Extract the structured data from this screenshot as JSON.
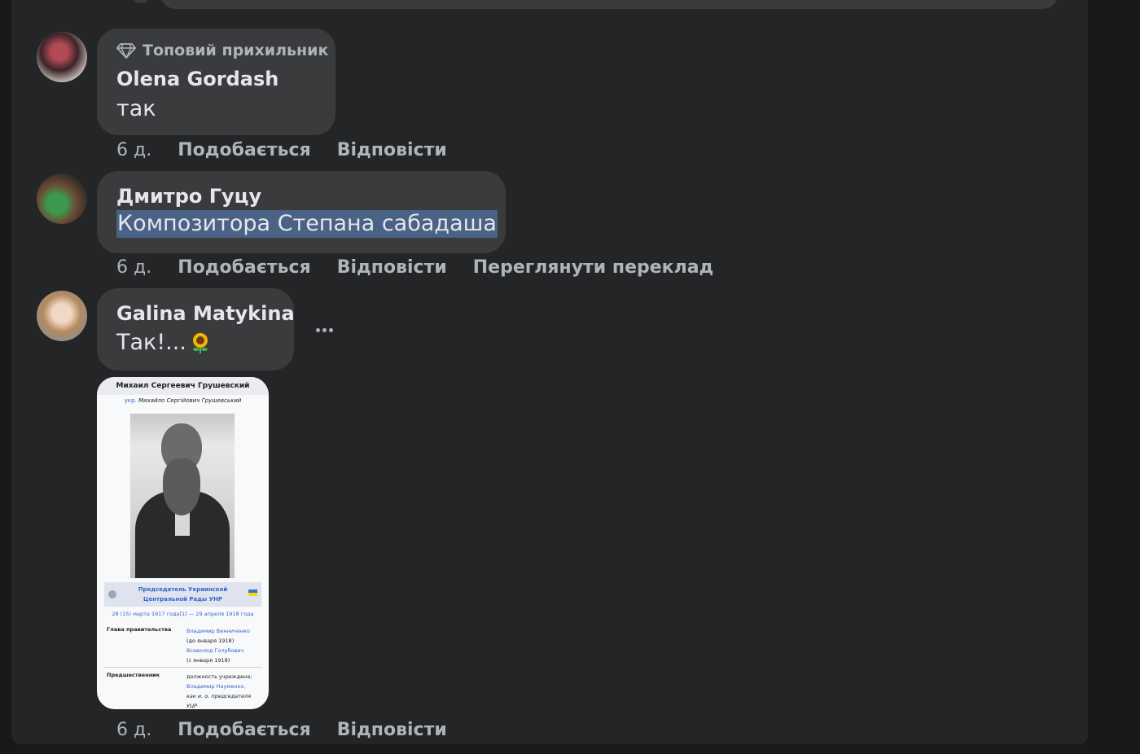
{
  "comments": [
    {
      "badge": "Топовий прихильник",
      "author": "Olena Gordash",
      "text": "так",
      "time": "6 д.",
      "like": "Подобається",
      "reply": "Відповісти"
    },
    {
      "author": "Дмитро Гуцу",
      "text": "Композитора Степана сабадаша",
      "time": "6 д.",
      "like": "Подобається",
      "reply": "Відповісти",
      "translate": "Переглянути переклад"
    },
    {
      "author": "Galina Matykina",
      "text": "Так!...",
      "time": "6 д.",
      "like": "Подобається",
      "reply": "Відповісти",
      "more": "•••"
    }
  ],
  "attachment": {
    "title": "Михаил Сергеевич Грушевский",
    "lang": "укр.",
    "subtitle": "Михайло Сергійович Грушевський",
    "role": "Председатель Украинской Центральной Рады УНР",
    "dates": "28 (15) марта 1917 года[1] — 29 апреля 1918 года",
    "rows": [
      {
        "key": "Глава правительства",
        "v1": "Владимир Винниченко",
        "v1note": "(до января 1918)",
        "v2": "Всеволод Голубович",
        "v2note": "(с января 1918)"
      },
      {
        "key": "Предшественник",
        "v1note": "должность учреждена;",
        "v1": "Владимир Науменко,",
        "v2note": "как и. о. председателя УЦР"
      }
    ]
  },
  "colors": {
    "background": "#18191a",
    "panel": "#242526",
    "bubble": "#3a3b3c",
    "text_primary": "#e4e6eb",
    "text_secondary": "#b0b3b8",
    "selection": "#4a6285"
  }
}
